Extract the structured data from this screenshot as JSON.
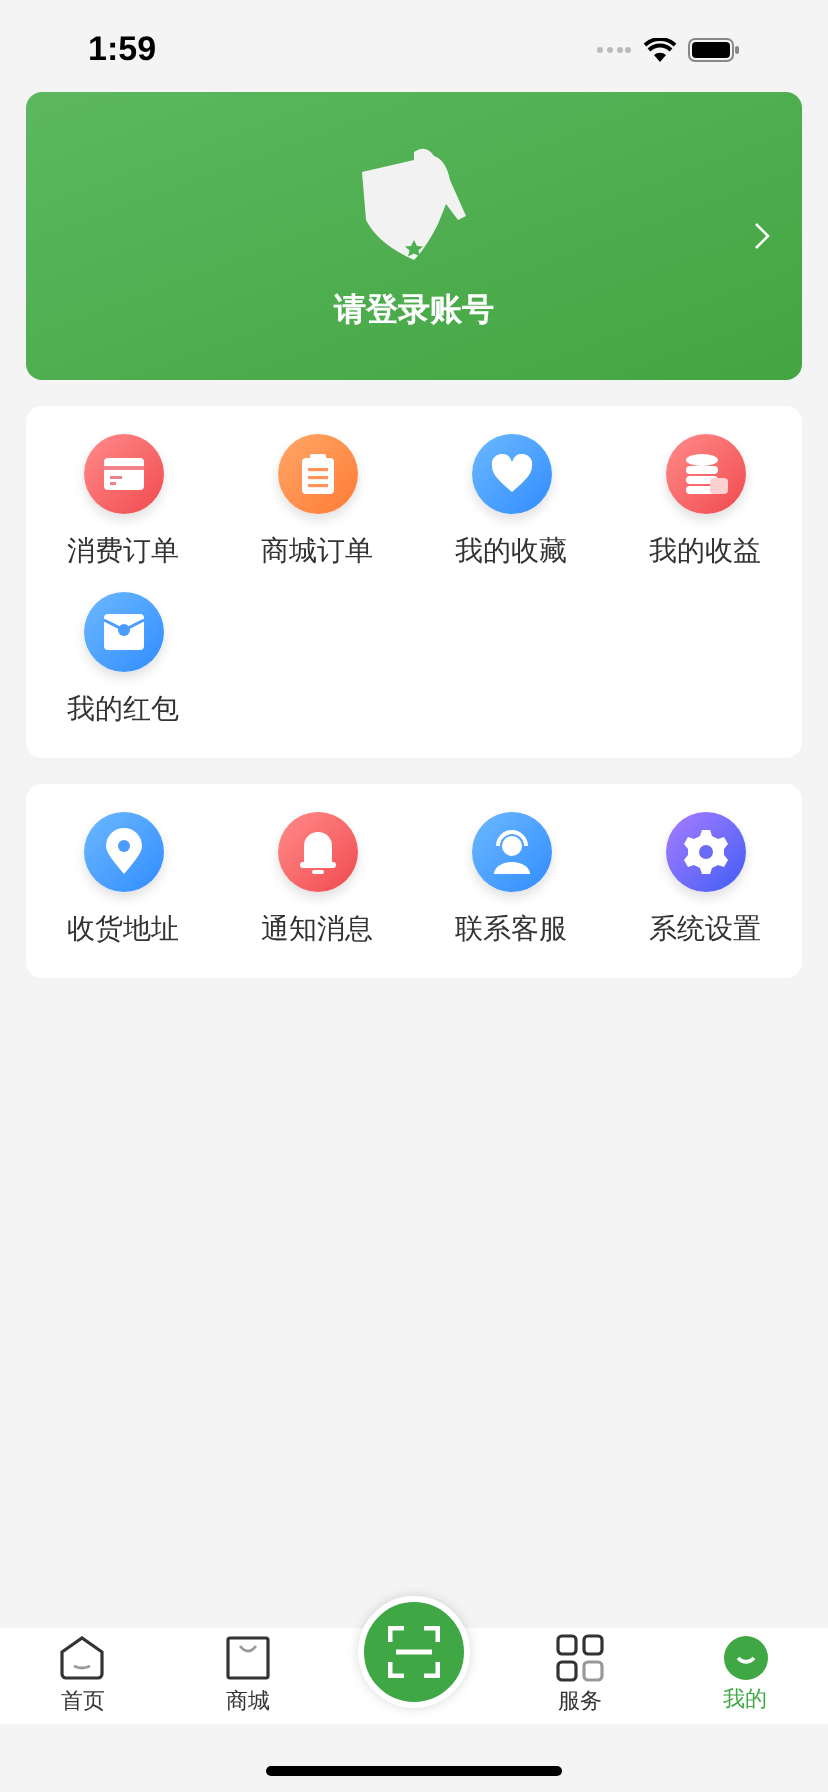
{
  "status_bar": {
    "time": "1:59"
  },
  "banner": {
    "title": "请登录账号"
  },
  "sections": [
    {
      "items": [
        {
          "label": "消费订单",
          "kind": "card"
        },
        {
          "label": "商城订单",
          "kind": "clipboard"
        },
        {
          "label": "我的收藏",
          "kind": "heart"
        },
        {
          "label": "我的收益",
          "kind": "coins"
        },
        {
          "label": "我的红包",
          "kind": "envelope"
        }
      ]
    },
    {
      "items": [
        {
          "label": "收货地址",
          "kind": "pin"
        },
        {
          "label": "通知消息",
          "kind": "bell"
        },
        {
          "label": "联系客服",
          "kind": "agent"
        },
        {
          "label": "系统设置",
          "kind": "gear"
        }
      ]
    }
  ],
  "tab_bar": [
    {
      "label": "首页",
      "kind": "home",
      "selected": false
    },
    {
      "label": "商城",
      "kind": "bag",
      "selected": false
    },
    {
      "kind": "scan"
    },
    {
      "label": "服务",
      "kind": "grid",
      "selected": false
    },
    {
      "label": "我的",
      "kind": "me",
      "selected": true
    }
  ]
}
